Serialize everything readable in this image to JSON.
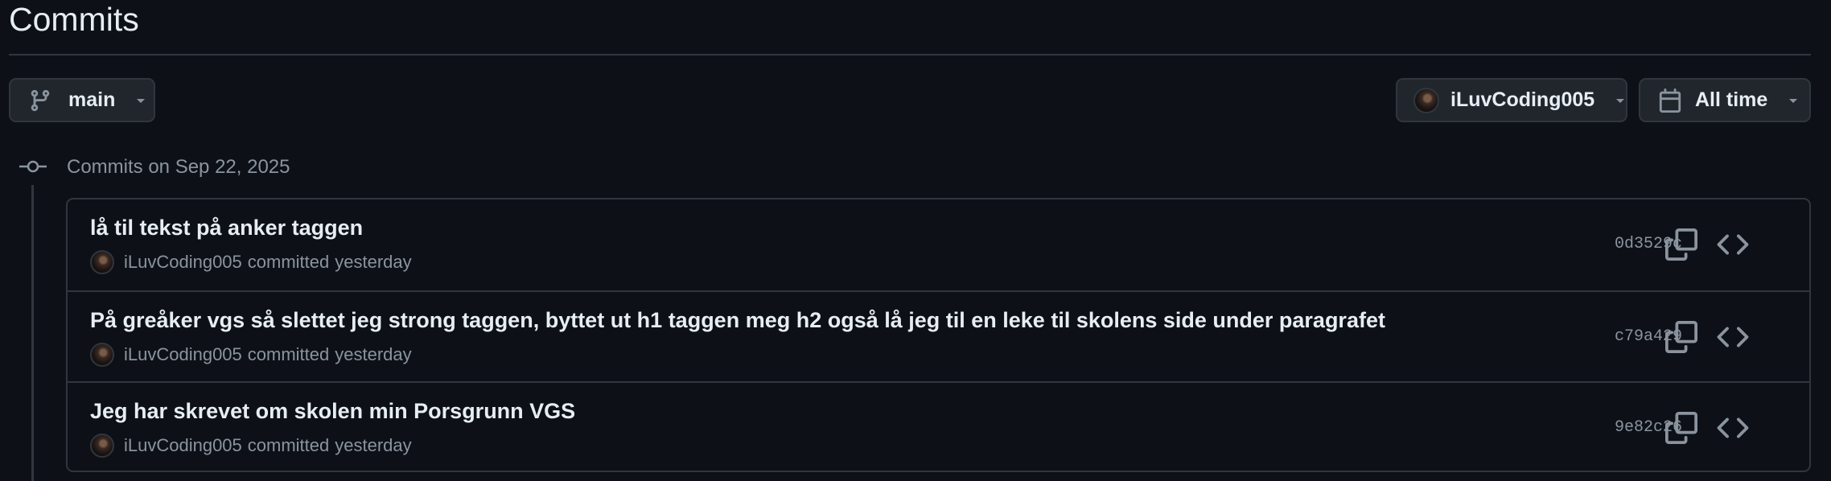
{
  "page": {
    "title": "Commits"
  },
  "filters": {
    "branch_label": "main",
    "author_label": "iLuvCoding005",
    "time_label": "All time"
  },
  "group": {
    "heading": "Commits on Sep 22, 2025"
  },
  "commits": [
    {
      "message": "lå til tekst på anker taggen",
      "author": "iLuvCoding005",
      "verb": "committed",
      "when": "yesterday",
      "sha": "0d3529c"
    },
    {
      "message": "På greåker vgs så slettet jeg strong taggen, byttet ut h1 taggen meg h2 også lå jeg til en leke til skolens side under paragrafet",
      "author": "iLuvCoding005",
      "verb": "committed",
      "when": "yesterday",
      "sha": "c79a429"
    },
    {
      "message": "Jeg har skrevet om skolen min Porsgrunn VGS",
      "author": "iLuvCoding005",
      "verb": "committed",
      "when": "yesterday",
      "sha": "9e82c26"
    }
  ],
  "icons": {
    "branch": "git-branch-icon",
    "calendar": "calendar-icon",
    "caret": "triangle-down-icon",
    "commit": "git-commit-icon",
    "copy": "copy-icon",
    "code": "code-icon"
  },
  "colors": {
    "background": "#0d1117",
    "border": "#30363d",
    "button_bg": "#21262d",
    "text_primary": "#e6edf3",
    "text_muted": "#8b949e"
  }
}
